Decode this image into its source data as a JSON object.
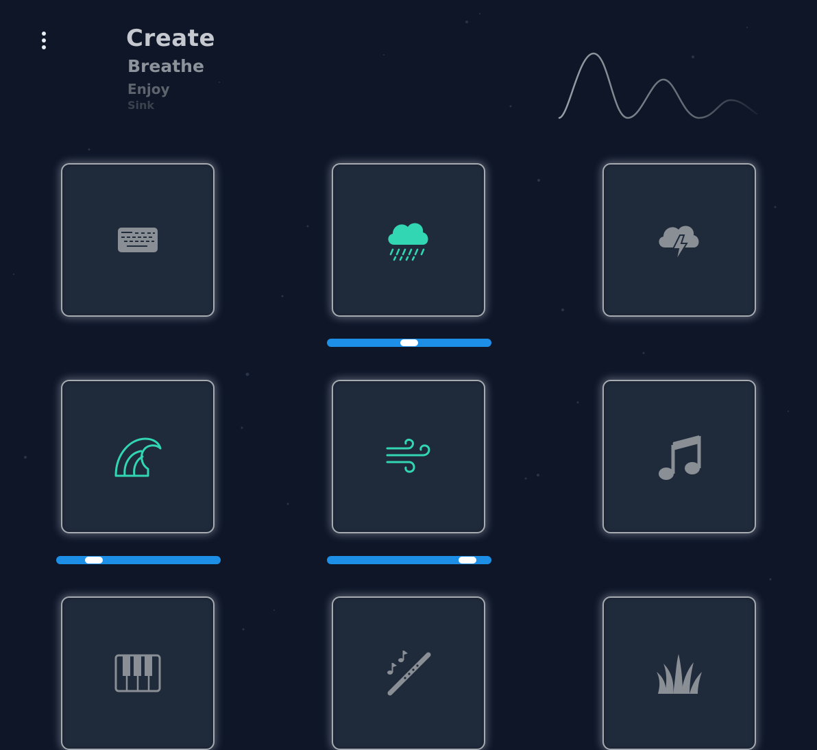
{
  "menu": {
    "icon": "more-vertical-icon"
  },
  "headline": {
    "words": [
      "Create",
      "Breathe",
      "Enjoy",
      "Sink"
    ]
  },
  "colors": {
    "background": "#0e1628",
    "tile": "#1f2a3b",
    "active_icon": "#33d6b3",
    "inactive_icon": "#8a8f96",
    "slider": "#1e8fe6"
  },
  "sounds": [
    {
      "icon": "keyboard-icon",
      "active": false
    },
    {
      "icon": "cloud-rain-icon",
      "active": true,
      "volume": 0.5
    },
    {
      "icon": "thunderstorm-icon",
      "active": false
    },
    {
      "icon": "ocean-wave-icon",
      "active": true,
      "volume": 0.23
    },
    {
      "icon": "wind-icon",
      "active": true,
      "volume": 0.86
    },
    {
      "icon": "music-note-icon",
      "active": false
    },
    {
      "icon": "piano-icon",
      "active": false
    },
    {
      "icon": "flute-icon",
      "active": false
    },
    {
      "icon": "grass-icon",
      "active": false
    }
  ]
}
